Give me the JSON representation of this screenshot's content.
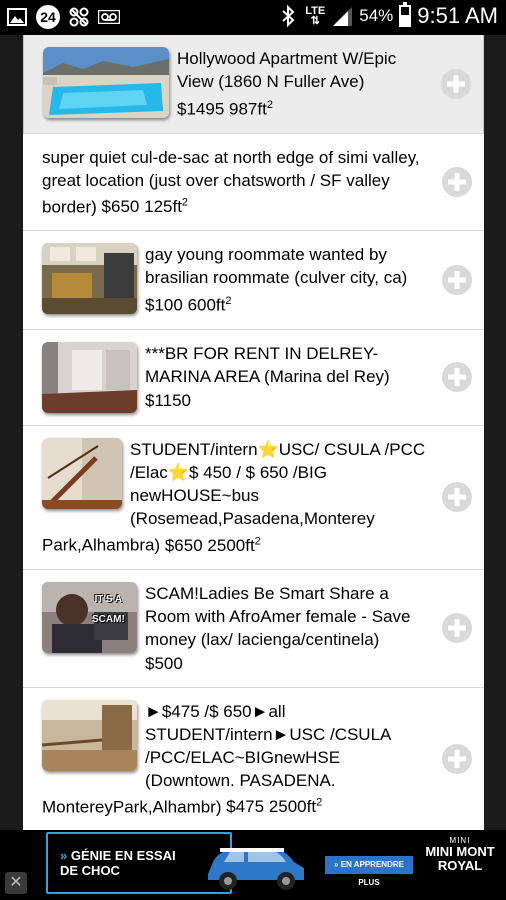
{
  "status_bar": {
    "notification_count": "24",
    "network": "LTE",
    "battery": "54%",
    "time": "9:51 AM"
  },
  "listings": [
    {
      "title": "Hollywood Apartment W/Epic View (1860 N Fuller Ave)",
      "price": "$1495",
      "area": "987ft",
      "area_exp": "2",
      "has_image": true
    },
    {
      "title": "super quiet cul-de-sac at north edge of simi valley, great location (just over chatsworth / SF valley border)",
      "price": "$650",
      "area": "125ft",
      "area_exp": "2",
      "has_image": false
    },
    {
      "title": "gay young roommate wanted by brasilian roommate (culver city, ca)",
      "price": "$100",
      "area": "600ft",
      "area_exp": "2",
      "has_image": true
    },
    {
      "title": "***BR FOR RENT IN DELREY- MARINA AREA (Marina del Rey)",
      "price": "$1150",
      "area": "",
      "area_exp": "",
      "has_image": true
    },
    {
      "title": "STUDENT/intern⭐USC/ CSULA /PCC /Elac⭐$ 450 / $ 650 /BIG newHOUSE~bus (Rosemead,Pasadena,Monterey Park,Alhambra)",
      "price": "$650",
      "area": "2500ft",
      "area_exp": "2",
      "has_image": true
    },
    {
      "title": "SCAM!Ladies Be Smart Share a Room with AfroAmer female - Save money (lax/ lacienga/centinela)",
      "price": "$500",
      "area": "",
      "area_exp": "",
      "has_image": true
    },
    {
      "title": "►$475 /$ 650►all STUDENT/intern►USC /CSULA /PCC/ELAC~BIGnewHSE (Downtown. PASADENA. MontereyPark,Alhambr)",
      "price": "$475",
      "area": "2500ft",
      "area_exp": "2",
      "has_image": true
    }
  ],
  "thumb_texts": {
    "scam_line1": "IT'S A",
    "scam_line2": "SCAM!"
  },
  "ad": {
    "headline_line1": "GÉNIE EN ESSAI",
    "headline_line2": "DE CHOC",
    "cta": "EN APPRENDRE PLUS",
    "brand_logo": "MINI",
    "brand_line1": "MINI MONT",
    "brand_line2": "ROYAL",
    "close": "✕"
  },
  "colors": {
    "accent": "#2aa7e0",
    "selected_bg": "#ececec"
  }
}
